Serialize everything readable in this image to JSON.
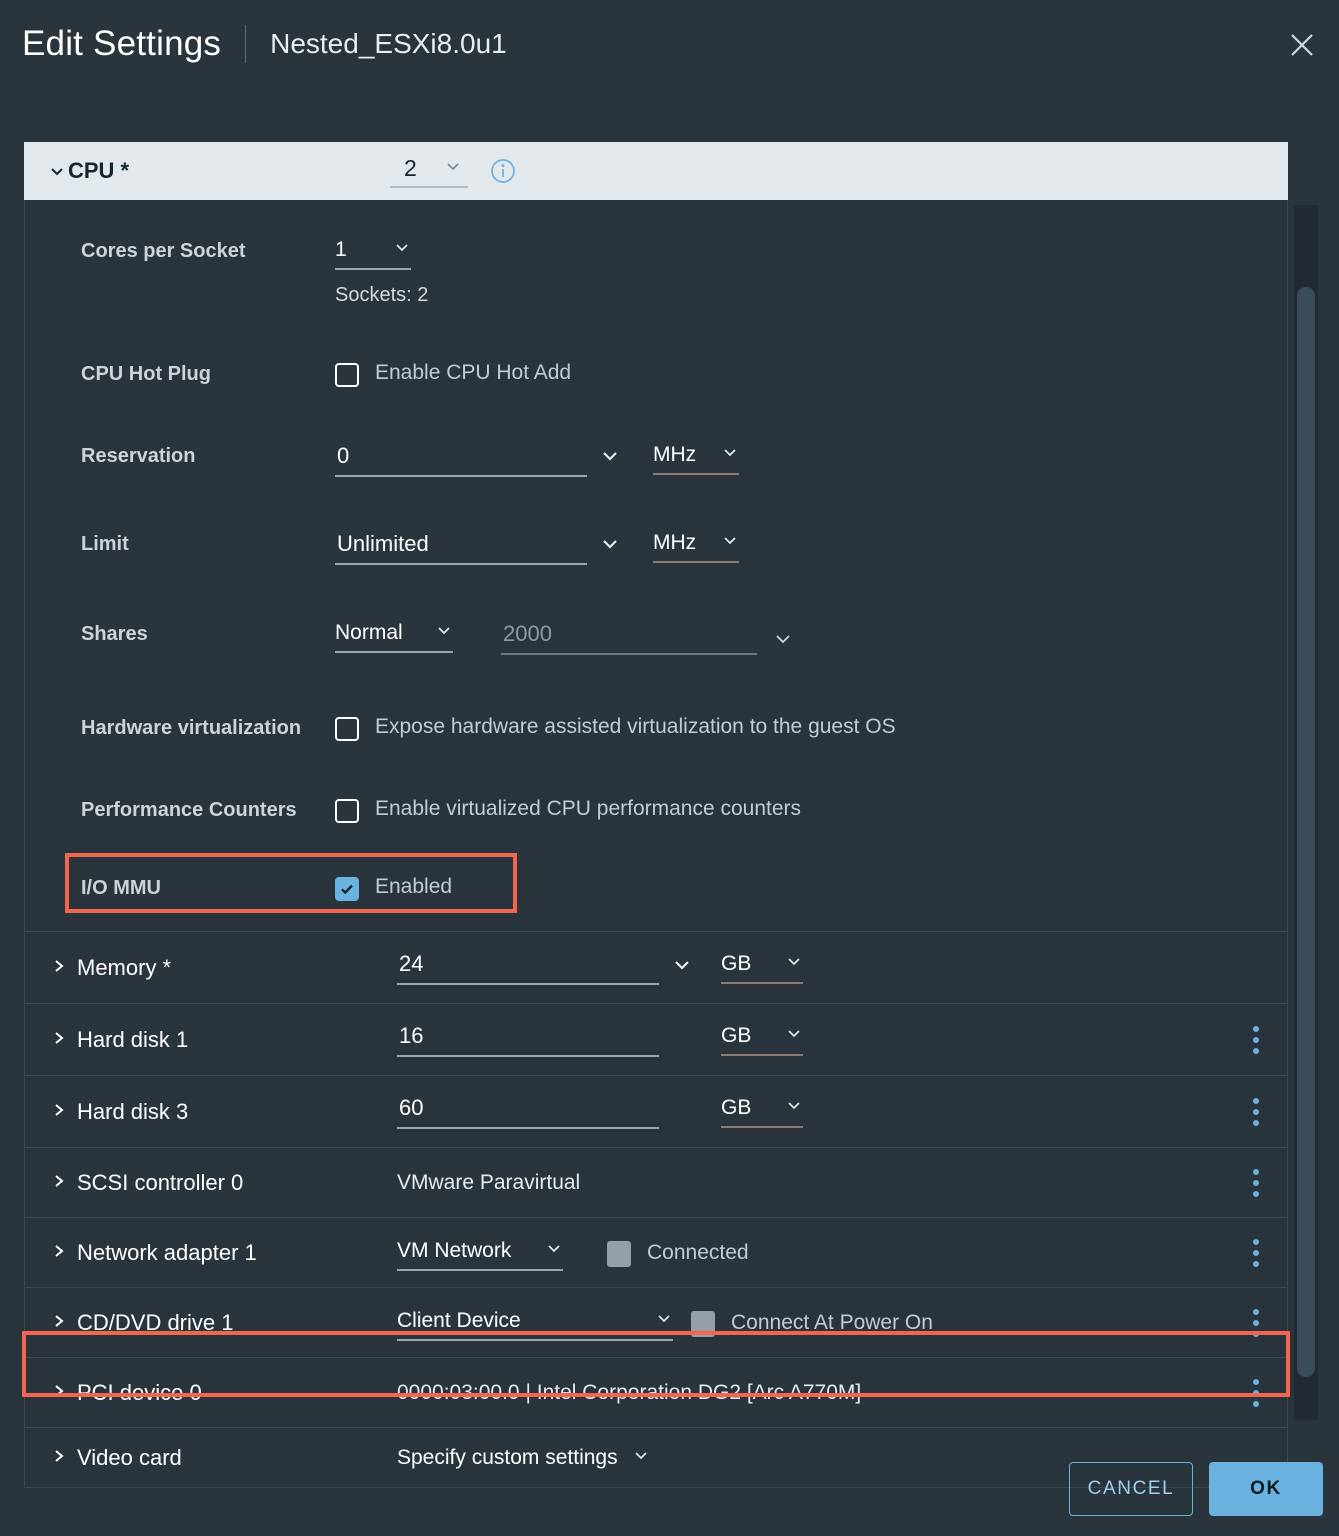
{
  "header": {
    "title": "Edit Settings",
    "vm_name": "Nested_ESXi8.0u1",
    "close_icon": "close-icon"
  },
  "cpu_section": {
    "label": "CPU *",
    "value": "2",
    "info_icon": "info-icon",
    "expanded": true,
    "rows": {
      "cores_per_socket": {
        "label": "Cores per Socket",
        "value": "1",
        "sockets_text": "Sockets: 2"
      },
      "cpu_hot_plug": {
        "label": "CPU Hot Plug",
        "checkbox_label": "Enable CPU Hot Add",
        "checked": false
      },
      "reservation": {
        "label": "Reservation",
        "value": "0",
        "unit": "MHz"
      },
      "limit": {
        "label": "Limit",
        "value": "Unlimited",
        "unit": "MHz"
      },
      "shares": {
        "label": "Shares",
        "level": "Normal",
        "amount": "2000"
      },
      "hardware_virtualization": {
        "label": "Hardware virtualization",
        "checkbox_label": "Expose hardware assisted virtualization to the guest OS",
        "checked": false
      },
      "performance_counters": {
        "label": "Performance Counters",
        "checkbox_label": "Enable virtualized CPU performance counters",
        "checked": false
      },
      "io_mmu": {
        "label": "I/O MMU",
        "checkbox_label": "Enabled",
        "checked": true,
        "highlighted": true
      }
    }
  },
  "devices": [
    {
      "label": "Memory *",
      "value": "24",
      "unit": "GB",
      "kebab": false
    },
    {
      "label": "Hard disk 1",
      "value": "16",
      "unit": "GB",
      "kebab": true
    },
    {
      "label": "Hard disk 3",
      "value": "60",
      "unit": "GB",
      "kebab": true
    },
    {
      "label": "SCSI controller 0",
      "value": "VMware Paravirtual",
      "kebab": true
    },
    {
      "label": "Network adapter 1",
      "value": "VM Network",
      "checkbox_label": "Connected",
      "kebab": true
    },
    {
      "label": "CD/DVD drive 1",
      "value": "Client Device",
      "checkbox_label": "Connect At Power On",
      "kebab": true
    },
    {
      "label": "PCI device 0",
      "value": "0000:03:00.0 | Intel Corporation DG2 [Arc A770M]",
      "kebab": true,
      "highlighted": true
    },
    {
      "label": "Video card",
      "value": "Specify custom settings",
      "kebab": false
    }
  ],
  "footer": {
    "cancel_label": "CANCEL",
    "ok_label": "OK"
  },
  "colors": {
    "background": "#2a343d",
    "band": "#e3e8ec",
    "accent": "#6ab3e0",
    "highlight": "#f2654f",
    "border": "#3d4a55"
  }
}
